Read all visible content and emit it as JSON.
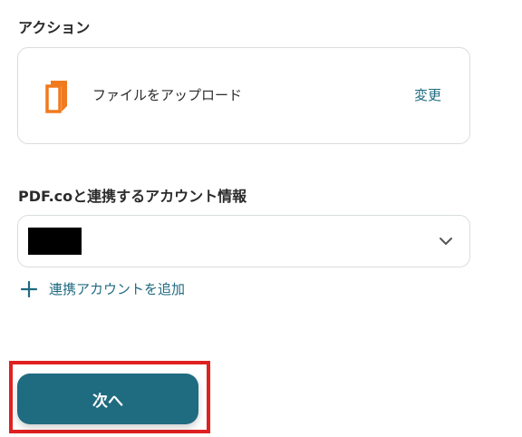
{
  "action_section": {
    "label": "アクション",
    "card": {
      "app_icon": "pdf-co-icon",
      "action_name": "ファイルをアップロード",
      "change_label": "変更"
    }
  },
  "account_section": {
    "label": "PDF.coと連携するアカウント情報",
    "select": {
      "selected_value_redacted": true,
      "chevron_icon": "chevron-down-icon"
    },
    "add_account_label": "連携アカウントを追加",
    "add_icon": "plus-icon"
  },
  "footer": {
    "next_label": "次へ",
    "highlight_color": "#e02020"
  },
  "colors": {
    "accent": "#1f6b80",
    "icon_orange": "#f07a1e",
    "border": "#d9dde0"
  }
}
